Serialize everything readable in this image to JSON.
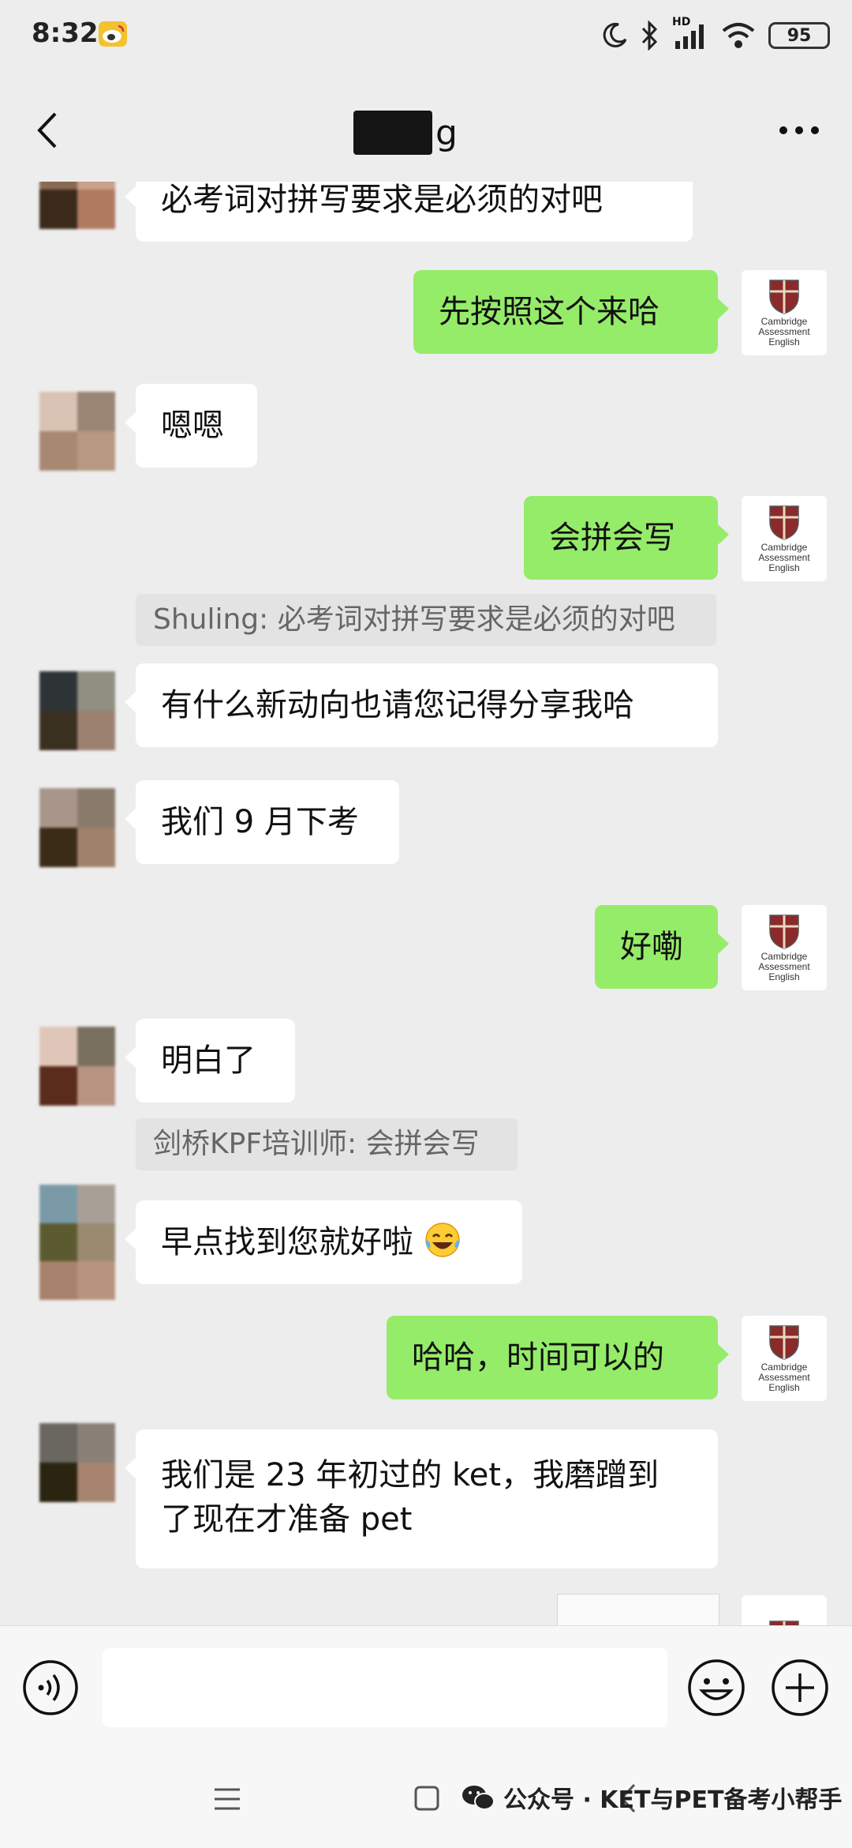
{
  "status_bar": {
    "time": "8:32",
    "hd_label": "HD",
    "battery": "95"
  },
  "header": {
    "title_suffix": "g"
  },
  "messages": [
    {
      "side": "in",
      "text": "必考词对拼写要求是必须的对吧"
    },
    {
      "side": "out",
      "text": "先按照这个来哈"
    },
    {
      "side": "in",
      "text": "嗯嗯"
    },
    {
      "side": "out",
      "text": "会拼会写"
    },
    {
      "side": "in",
      "quote": "Shuling: 必考词对拼写要求是必须的对吧",
      "text": "有什么新动向也请您记得分享我哈"
    },
    {
      "side": "in",
      "text": "我们 9 月下考"
    },
    {
      "side": "out",
      "text": "好嘞"
    },
    {
      "side": "in",
      "text": "明白了"
    },
    {
      "side": "in",
      "quote": "剑桥KPF培训师: 会拼会写",
      "text": "早点找到您就好啦",
      "emoji": "laughing-tears"
    },
    {
      "side": "out",
      "text": "哈哈，时间可以的"
    },
    {
      "side": "in",
      "text_lines": [
        "我们是 23 年初过的 ket，我磨蹭到",
        "了现在才准备 pet"
      ]
    }
  ],
  "logo": {
    "line1": "Cambridge",
    "line2": "Assessment",
    "line3": "English"
  },
  "input_bar": {
    "placeholder": ""
  },
  "watermark": {
    "text": "公众号 · KET与PET备考小帮手"
  },
  "colors": {
    "background": "#ededed",
    "outgoing_bubble": "#95ec69",
    "incoming_bubble": "#ffffff"
  },
  "icons": [
    "weibo-icon",
    "moon-icon",
    "bluetooth-icon",
    "signal-icon",
    "wifi-icon",
    "battery-icon",
    "back-arrow-icon",
    "more-icon",
    "voice-icon",
    "emoji-icon",
    "plus-icon",
    "wechat-icon"
  ]
}
